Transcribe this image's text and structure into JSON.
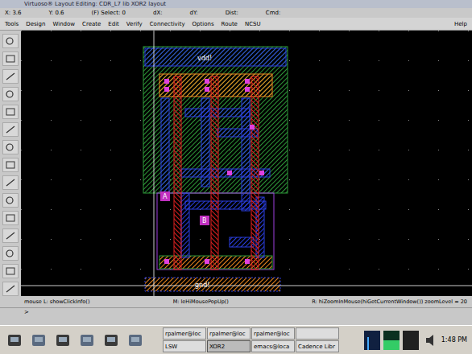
{
  "window": {
    "title": "Virtuoso® Layout Editing: CDR_L7 lib XOR2 layout"
  },
  "info": [
    "X: 3.6",
    "Y: 0.6",
    "(F) Select: 0",
    "dX:",
    "dY:",
    "Dist:",
    "Cmd:"
  ],
  "menu": [
    "Tools",
    "Design",
    "Window",
    "Create",
    "Edit",
    "Verify",
    "Connectivity",
    "Options",
    "Route",
    "NCSU"
  ],
  "help": "Help",
  "canvas": {
    "rails": [
      {
        "text": "vdd!"
      },
      {
        "text": "gnd!"
      }
    ],
    "pins": [
      {
        "text": "A"
      },
      {
        "text": "B"
      }
    ]
  },
  "status": {
    "mouse_l": "mouse L: showClickInfo()",
    "mouse_m": "M: leHiMousePopUp()",
    "mouse_r": "R: hiZoomInMouse(hiGetCurrentWindow()) zoomLevel = 20"
  },
  "prompt": ">",
  "taskbar": {
    "tasks": [
      {
        "label": "rpalmer@loc",
        "selected": false
      },
      {
        "label": "rpalmer@loc",
        "selected": false
      },
      {
        "label": "rpalmer@loc",
        "selected": false
      },
      {
        "label": "",
        "selected": false
      },
      {
        "label": "LSW",
        "selected": false
      },
      {
        "label": "XOR2",
        "selected": true
      },
      {
        "label": "emacs@loca",
        "selected": false
      },
      {
        "label": "Cadence Libr",
        "selected": false
      }
    ],
    "clock": "1:48 PM"
  }
}
